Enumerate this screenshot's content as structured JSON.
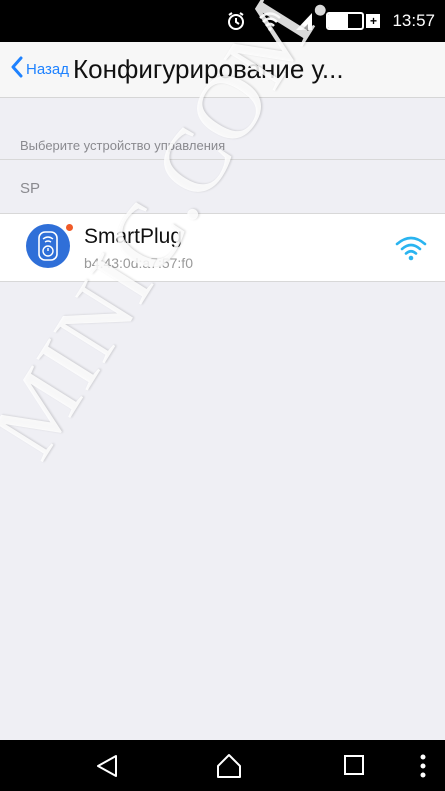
{
  "status_bar": {
    "battery_text": "57%",
    "battery_level": 0.57,
    "charging_symbol": "+",
    "time": "13:57",
    "icons": [
      "alarm-icon",
      "wifi-icon",
      "cellular-signal-icon",
      "battery-icon"
    ]
  },
  "nav": {
    "back_label": "Назад",
    "title": "Конфигурирование у..."
  },
  "section": {
    "label": "Выберите устройство управления"
  },
  "group": {
    "label": "SP"
  },
  "device": {
    "name": "SmartPlug",
    "mac": "b4:43:0d:a7:57:f0",
    "icon": "smartplug-icon",
    "signal_icon": "wifi-signal-icon",
    "accent_color": "#2f6fd8",
    "status_dot_color": "#f05a28"
  },
  "watermark": {
    "text": "MINIC.COM.UA"
  },
  "colors": {
    "link_blue": "#1e82ff",
    "wifi_blue": "#2ab4f0"
  },
  "bottom_nav": {
    "icons": [
      "back-icon",
      "home-icon",
      "recents-icon",
      "overflow-menu-icon"
    ]
  }
}
